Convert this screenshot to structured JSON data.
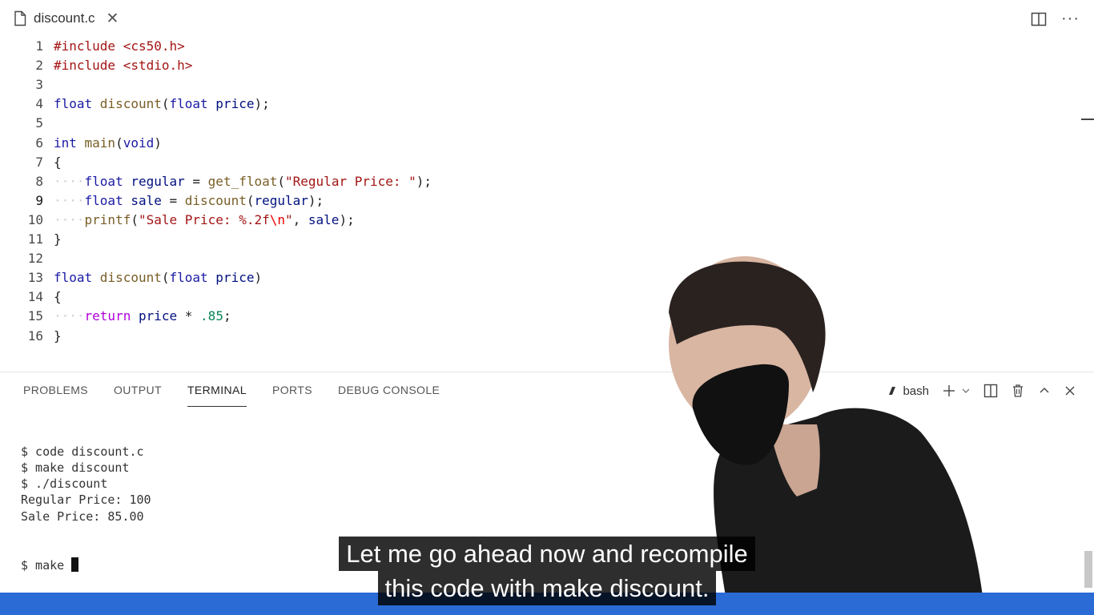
{
  "tab": {
    "title": "discount.c",
    "close": "✕"
  },
  "top_actions": {
    "more": "···"
  },
  "editor": {
    "lines": [
      {
        "n": "1",
        "segments": [
          {
            "t": "#include ",
            "c": "pp"
          },
          {
            "t": "<cs50.h>",
            "c": "pp"
          }
        ]
      },
      {
        "n": "2",
        "segments": [
          {
            "t": "#include ",
            "c": "pp"
          },
          {
            "t": "<stdio.h>",
            "c": "pp"
          }
        ]
      },
      {
        "n": "3",
        "segments": []
      },
      {
        "n": "4",
        "segments": [
          {
            "t": "float ",
            "c": "kw"
          },
          {
            "t": "discount",
            "c": "fn"
          },
          {
            "t": "(",
            "c": ""
          },
          {
            "t": "float ",
            "c": "kw"
          },
          {
            "t": "price",
            "c": "var"
          },
          {
            "t": ");",
            "c": ""
          }
        ]
      },
      {
        "n": "5",
        "segments": []
      },
      {
        "n": "6",
        "segments": [
          {
            "t": "int ",
            "c": "kw"
          },
          {
            "t": "main",
            "c": "fn"
          },
          {
            "t": "(",
            "c": ""
          },
          {
            "t": "void",
            "c": "kw"
          },
          {
            "t": ")",
            "c": ""
          }
        ]
      },
      {
        "n": "7",
        "segments": [
          {
            "t": "{",
            "c": ""
          }
        ]
      },
      {
        "n": "8",
        "segments": [
          {
            "t": "····",
            "c": "ws"
          },
          {
            "t": "float ",
            "c": "kw"
          },
          {
            "t": "regular",
            "c": "var"
          },
          {
            "t": " = ",
            "c": ""
          },
          {
            "t": "get_float",
            "c": "fn"
          },
          {
            "t": "(",
            "c": ""
          },
          {
            "t": "\"Regular Price: \"",
            "c": "str"
          },
          {
            "t": ");",
            "c": ""
          }
        ]
      },
      {
        "n": "9",
        "segments": [
          {
            "t": "····",
            "c": "ws"
          },
          {
            "t": "float ",
            "c": "kw"
          },
          {
            "t": "sale",
            "c": "var"
          },
          {
            "t": " = ",
            "c": ""
          },
          {
            "t": "discount",
            "c": "fn"
          },
          {
            "t": "(",
            "c": ""
          },
          {
            "t": "regular",
            "c": "var"
          },
          {
            "t": ");",
            "c": ""
          }
        ]
      },
      {
        "n": "10",
        "segments": [
          {
            "t": "····",
            "c": "ws"
          },
          {
            "t": "printf",
            "c": "fn"
          },
          {
            "t": "(",
            "c": ""
          },
          {
            "t": "\"Sale Price: %.2f",
            "c": "str"
          },
          {
            "t": "\\n",
            "c": "esc"
          },
          {
            "t": "\"",
            "c": "str"
          },
          {
            "t": ", ",
            "c": ""
          },
          {
            "t": "sale",
            "c": "var"
          },
          {
            "t": ");",
            "c": ""
          }
        ]
      },
      {
        "n": "11",
        "segments": [
          {
            "t": "}",
            "c": ""
          }
        ]
      },
      {
        "n": "12",
        "segments": []
      },
      {
        "n": "13",
        "segments": [
          {
            "t": "float ",
            "c": "kw"
          },
          {
            "t": "discount",
            "c": "fn"
          },
          {
            "t": "(",
            "c": ""
          },
          {
            "t": "float ",
            "c": "kw"
          },
          {
            "t": "price",
            "c": "var"
          },
          {
            "t": ")",
            "c": ""
          }
        ]
      },
      {
        "n": "14",
        "segments": [
          {
            "t": "{",
            "c": ""
          }
        ]
      },
      {
        "n": "15",
        "segments": [
          {
            "t": "····",
            "c": "ws"
          },
          {
            "t": "return ",
            "c": "ret"
          },
          {
            "t": "price",
            "c": "var"
          },
          {
            "t": " * ",
            "c": ""
          },
          {
            "t": ".85",
            "c": "num"
          },
          {
            "t": ";",
            "c": ""
          }
        ]
      },
      {
        "n": "16",
        "segments": [
          {
            "t": "}",
            "c": ""
          }
        ]
      }
    ],
    "active_line": "9"
  },
  "panel": {
    "tabs": [
      {
        "label": "PROBLEMS",
        "active": false
      },
      {
        "label": "OUTPUT",
        "active": false
      },
      {
        "label": "TERMINAL",
        "active": true
      },
      {
        "label": "PORTS",
        "active": false
      },
      {
        "label": "DEBUG CONSOLE",
        "active": false
      }
    ],
    "shell_label": "bash"
  },
  "terminal": {
    "lines": [
      "$ code discount.c",
      "$ make discount",
      "$ ./discount",
      "Regular Price: 100",
      "Sale Price: 85.00"
    ],
    "prompt": "$ make "
  },
  "caption": {
    "line1": "Let me go ahead now and recompile",
    "line2": "this code with make discount."
  },
  "colors": {
    "statusbar": "#2a6bd6",
    "keyword": "#1a1aa6",
    "string": "#a31515",
    "function": "#795e26"
  }
}
